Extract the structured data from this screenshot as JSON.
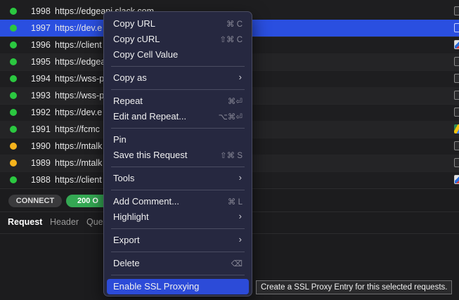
{
  "rows": [
    {
      "id": "1998",
      "url": "https://edgeapi.slack.com",
      "status_color": "#2bc840",
      "icon": "file-icon"
    },
    {
      "id": "1997",
      "url": "https://dev.e",
      "status_color": "#2bc840",
      "icon": "file-icon",
      "selected": true
    },
    {
      "id": "1996",
      "url": "https://client",
      "status_color": "#2bc840",
      "icon": "slack-icon"
    },
    {
      "id": "1995",
      "url": "https://edgea",
      "status_color": "#2bc840",
      "icon": "file-icon"
    },
    {
      "id": "1994",
      "url": "https://wss-p",
      "status_color": "#2bc840",
      "icon": "file-icon"
    },
    {
      "id": "1993",
      "url": "https://wss-p",
      "status_color": "#2bc840",
      "icon": "file-icon"
    },
    {
      "id": "1992",
      "url": "https://dev.e",
      "status_color": "#2bc840",
      "icon": "file-icon"
    },
    {
      "id": "1991",
      "url": "https://fcmc",
      "status_color": "#2bc840",
      "icon": "google-drive-icon"
    },
    {
      "id": "1990",
      "url": "https://mtalk",
      "status_color": "#f5b31c",
      "icon": "file-icon"
    },
    {
      "id": "1989",
      "url": "https://mtalk",
      "status_color": "#f5b31c",
      "icon": "file-icon"
    },
    {
      "id": "1988",
      "url": "https://client",
      "status_color": "#2bc840",
      "icon": "slack-icon"
    }
  ],
  "status_pills": {
    "method": "CONNECT",
    "code": "200 O"
  },
  "tabs": [
    "Request",
    "Header",
    "Que"
  ],
  "context_menu": {
    "items": [
      {
        "label": "Copy URL",
        "shortcut": "⌘ C"
      },
      {
        "label": "Copy cURL",
        "shortcut": "⇧⌘ C"
      },
      {
        "label": "Copy Cell Value",
        "shortcut": ""
      },
      {
        "separator": true
      },
      {
        "label": "Copy as",
        "submenu": true
      },
      {
        "separator": true
      },
      {
        "label": "Repeat",
        "shortcut": "⌘⏎"
      },
      {
        "label": "Edit and Repeat...",
        "shortcut": "⌥⌘⏎"
      },
      {
        "separator": true
      },
      {
        "label": "Pin",
        "shortcut": ""
      },
      {
        "label": "Save this Request",
        "shortcut": "⇧⌘ S"
      },
      {
        "separator": true
      },
      {
        "label": "Tools",
        "submenu": true
      },
      {
        "separator": true
      },
      {
        "label": "Add Comment...",
        "shortcut": "⌘ L"
      },
      {
        "label": "Highlight",
        "submenu": true
      },
      {
        "separator": true
      },
      {
        "label": "Export",
        "submenu": true
      },
      {
        "separator": true
      },
      {
        "label": "Delete",
        "shortcut": "⌫"
      },
      {
        "separator": true
      },
      {
        "label": "Enable SSL Proxying",
        "shortcut": "",
        "highlighted": true
      }
    ]
  },
  "tooltip": "Create a SSL Proxy Entry for this selected requests."
}
